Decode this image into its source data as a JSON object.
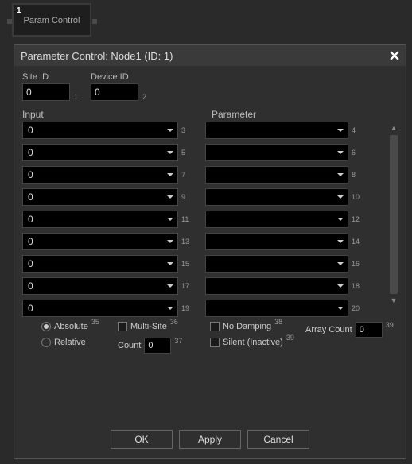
{
  "node": {
    "number": "1",
    "label": "Param Control"
  },
  "dialog": {
    "title": "Parameter Control: Node1 (ID: 1)"
  },
  "fields": {
    "site_id": {
      "label": "Site ID",
      "value": "0",
      "sup": "1"
    },
    "device_id": {
      "label": "Device ID",
      "value": "0",
      "sup": "2"
    }
  },
  "columns": {
    "input": "Input",
    "parameter": "Parameter"
  },
  "rows": [
    {
      "input": "0",
      "input_sup": "3",
      "param": "",
      "param_sup": "4"
    },
    {
      "input": "0",
      "input_sup": "5",
      "param": "",
      "param_sup": "6"
    },
    {
      "input": "0",
      "input_sup": "7",
      "param": "",
      "param_sup": "8"
    },
    {
      "input": "0",
      "input_sup": "9",
      "param": "",
      "param_sup": "10"
    },
    {
      "input": "0",
      "input_sup": "11",
      "param": "",
      "param_sup": "12"
    },
    {
      "input": "0",
      "input_sup": "13",
      "param": "",
      "param_sup": "14"
    },
    {
      "input": "0",
      "input_sup": "15",
      "param": "",
      "param_sup": "16"
    },
    {
      "input": "0",
      "input_sup": "17",
      "param": "",
      "param_sup": "18"
    },
    {
      "input": "0",
      "input_sup": "19",
      "param": "",
      "param_sup": "20"
    }
  ],
  "options": {
    "absolute": {
      "label": "Absolute",
      "checked": true,
      "sup": "35"
    },
    "relative": {
      "label": "Relative",
      "checked": false
    },
    "multisite": {
      "label": "Multi-Site",
      "checked": false,
      "sup": "36"
    },
    "count": {
      "label": "Count",
      "value": "0",
      "sup": "37"
    },
    "nodamping": {
      "label": "No Damping",
      "checked": false,
      "sup": "38"
    },
    "silent": {
      "label": "Silent (Inactive)",
      "checked": false,
      "sup": "39"
    },
    "arraycount": {
      "label": "Array Count",
      "value": "0",
      "sup": "39"
    }
  },
  "buttons": {
    "ok": "OK",
    "apply": "Apply",
    "cancel": "Cancel"
  }
}
